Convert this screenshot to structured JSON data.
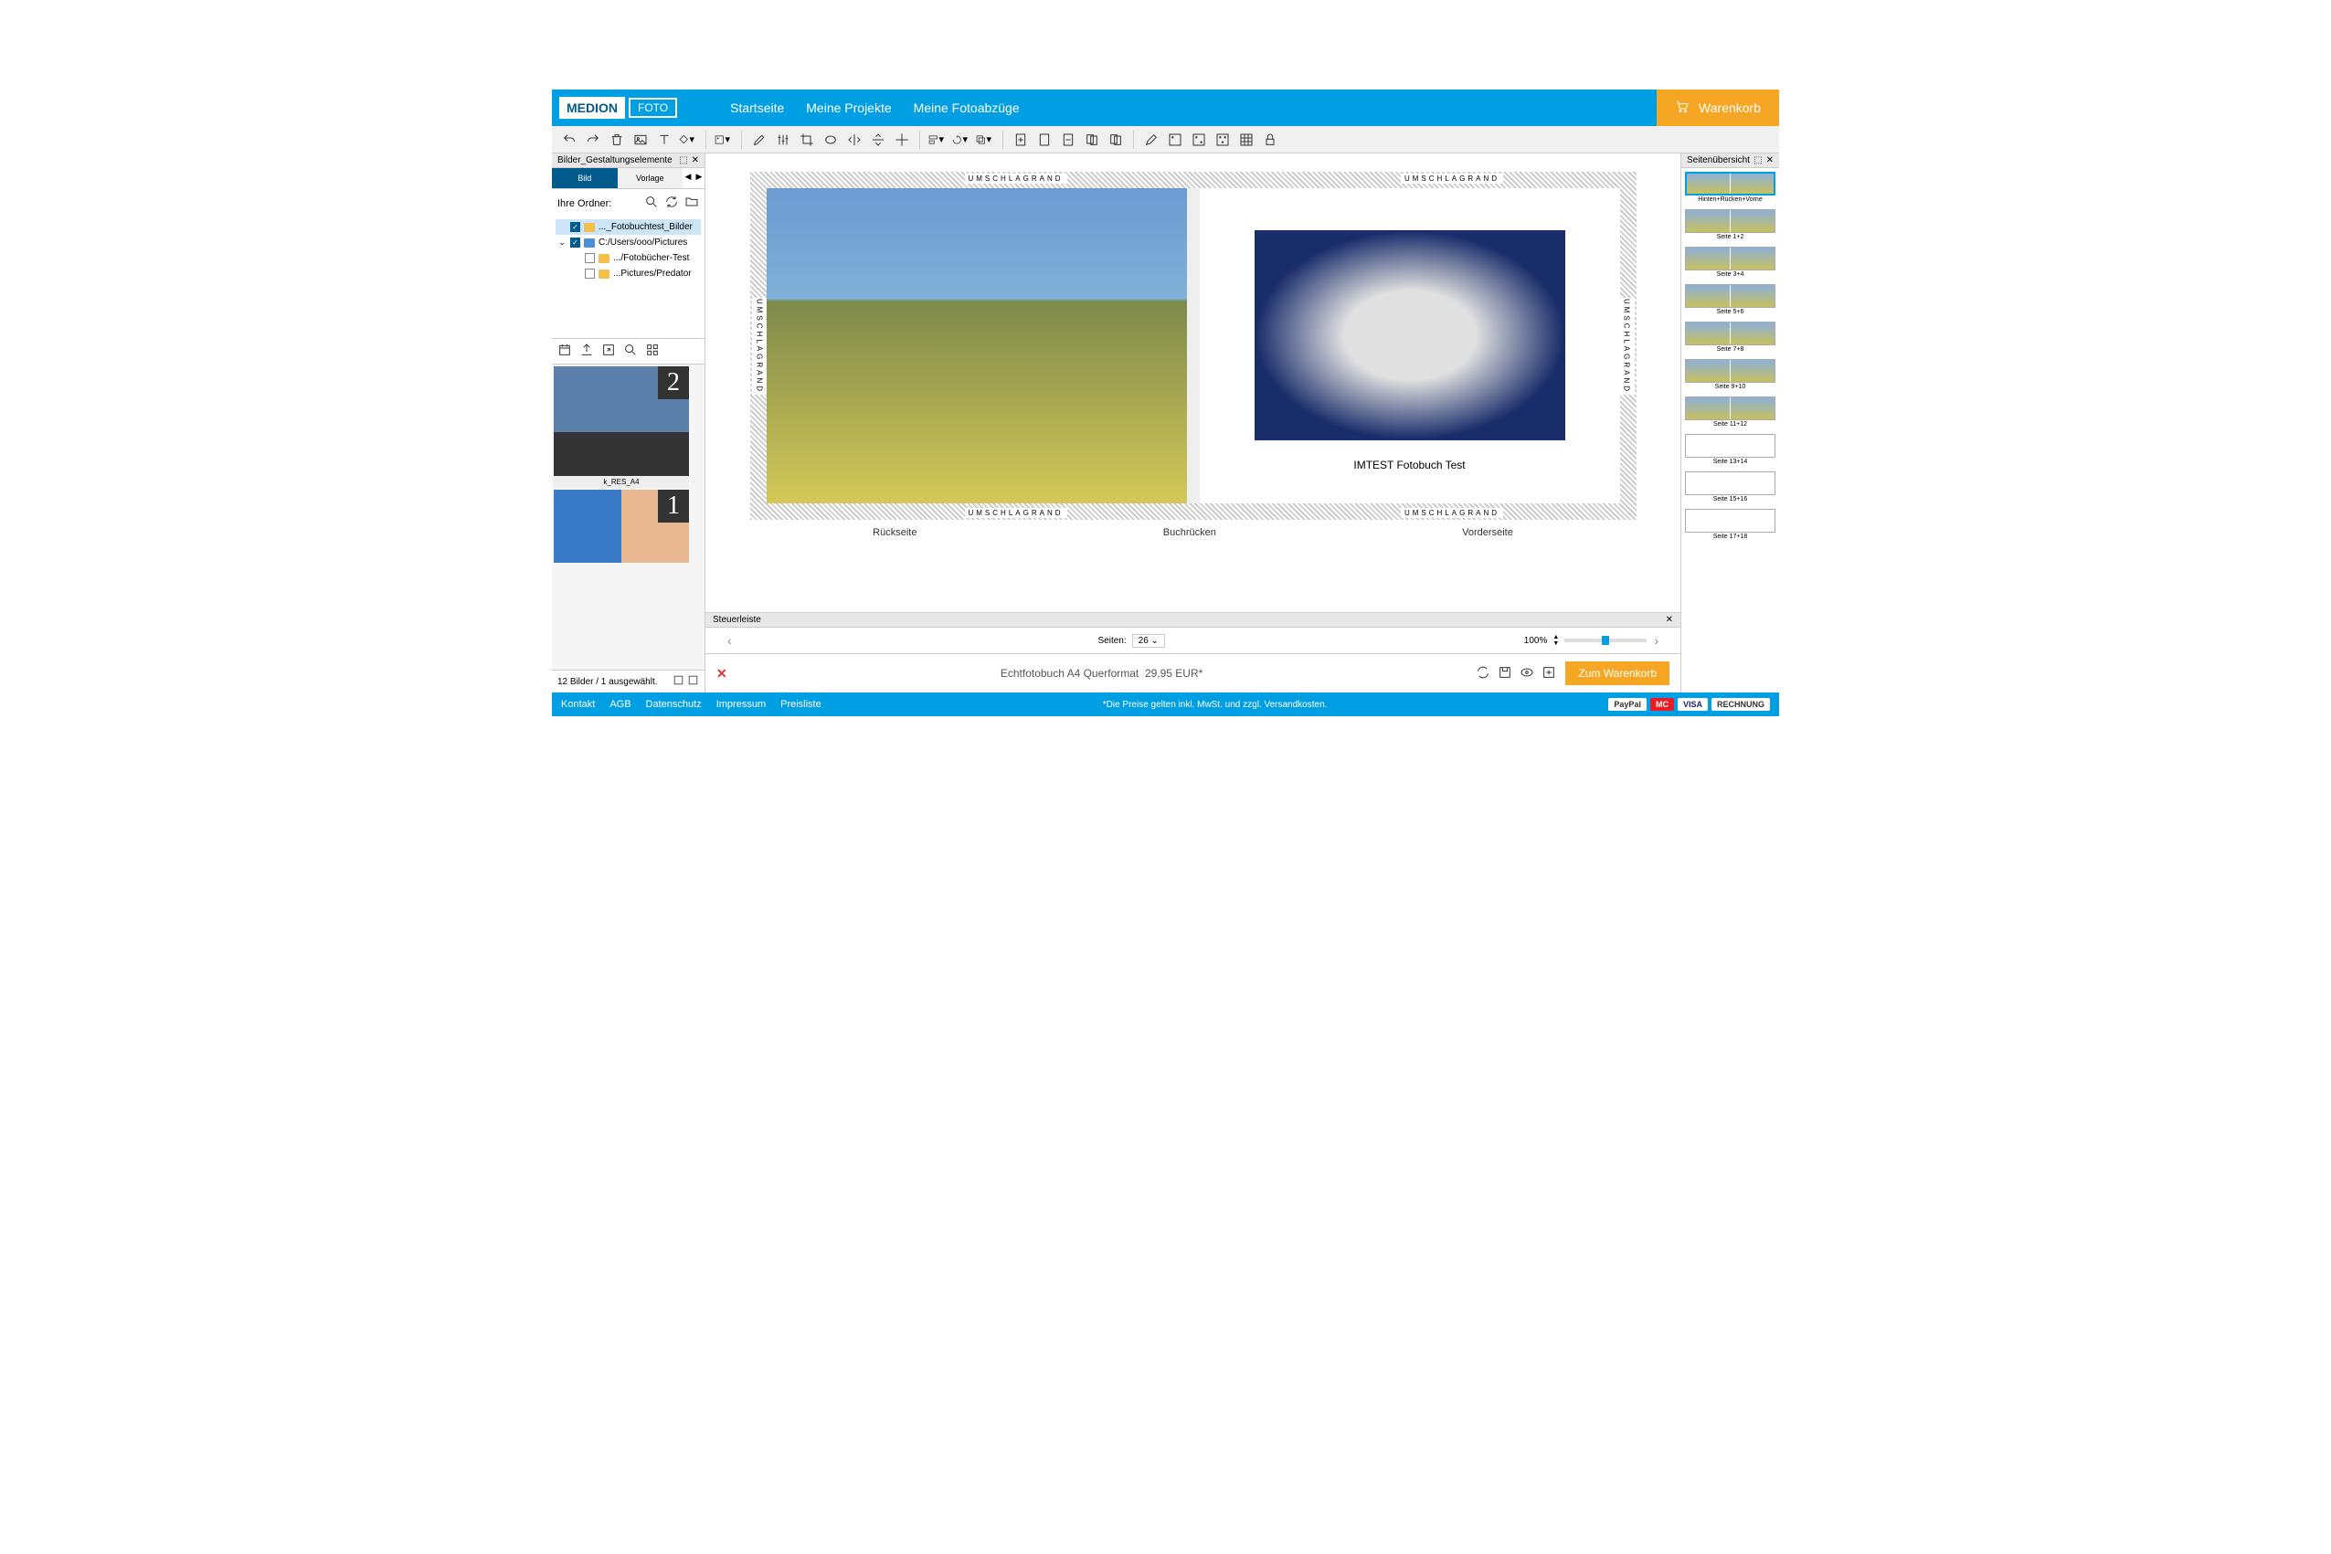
{
  "brand": {
    "name": "MEDION",
    "sub": "FOTO"
  },
  "nav": {
    "home": "Startseite",
    "projects": "Meine Projekte",
    "prints": "Meine Fotoabzüge",
    "cart": "Warenkorb"
  },
  "left_panel": {
    "title": "Bilder_Gestaltungselemente",
    "tab_image": "Bild",
    "tab_template": "Vorlage",
    "folders_label": "Ihre Ordner:",
    "folders": [
      {
        "name": "..._Fotobuchtest_Bilder",
        "checked": true,
        "selected": true,
        "type": "folder"
      },
      {
        "name": "C:/Users/ooo/Pictures",
        "checked": true,
        "type": "img",
        "expandable": true
      },
      {
        "name": ".../Fotobücher-Test",
        "checked": false,
        "type": "folder",
        "indent": 1
      },
      {
        "name": "...Pictures/Predator",
        "checked": false,
        "type": "folder",
        "indent": 1
      }
    ],
    "thumbs": [
      {
        "badge": "2",
        "label": "k_RES_A4"
      },
      {
        "badge": "1",
        "label": ""
      }
    ],
    "footer": "12 Bilder / 1 ausgewählt."
  },
  "canvas": {
    "margin_label": "UMSCHLAGRAND",
    "cover_title": "IMTEST Fotobuch Test",
    "back_label": "Rückseite",
    "spine_label": "Buchrücken",
    "front_label": "Vorderseite"
  },
  "right_panel": {
    "title": "Seitenübersicht",
    "pages": [
      {
        "label": "Hinten+Rücken+Vorne",
        "selected": true
      },
      {
        "label": "Seite 1+2"
      },
      {
        "label": "Seite 3+4"
      },
      {
        "label": "Seite 5+6"
      },
      {
        "label": "Seite 7+8"
      },
      {
        "label": "Seite 9+10"
      },
      {
        "label": "Seite 11+12"
      },
      {
        "label": "Seite 13+14",
        "blank": true
      },
      {
        "label": "Seite 15+16",
        "blank": true
      },
      {
        "label": "Seite 17+18",
        "blank": true
      }
    ]
  },
  "controls": {
    "steuerleiste": "Steuerleiste",
    "pages_label": "Seiten:",
    "pages_value": "26",
    "zoom_label": "100%"
  },
  "product": {
    "name": "Echtfotobuch A4 Querformat",
    "price": "29,95 EUR*",
    "add_to_cart": "Zum Warenkorb"
  },
  "footer": {
    "links": {
      "kontakt": "Kontakt",
      "agb": "AGB",
      "datenschutz": "Datenschutz",
      "impressum": "Impressum",
      "preisliste": "Preisliste"
    },
    "note": "*Die Preise gelten inkl. MwSt. und zzgl. Versandkosten.",
    "badges": [
      "PayPal",
      "MC",
      "VISA",
      "RECHNUNG"
    ]
  }
}
